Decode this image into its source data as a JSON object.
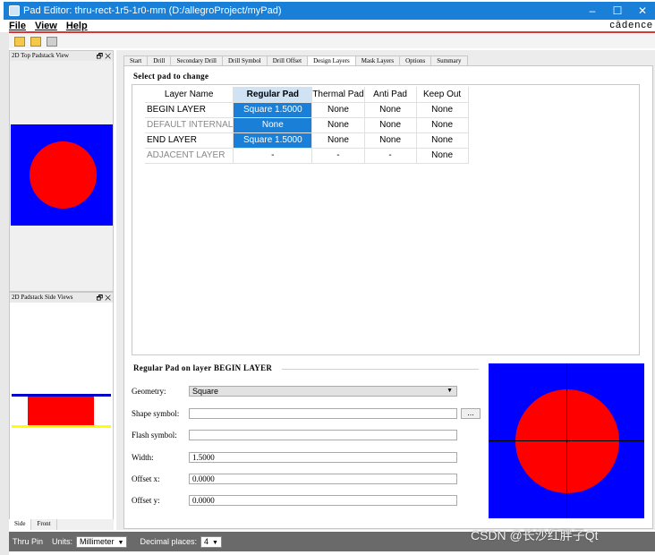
{
  "window": {
    "title": "Pad Editor: thru-rect-1r5-1r0-mm  (D:/allegroProject/myPad)",
    "minimize": "–",
    "maximize": "☐",
    "close": "✕"
  },
  "menu": {
    "items": [
      "File",
      "View",
      "Help"
    ],
    "brand": "cādence"
  },
  "panels": {
    "top_view_title": "2D Top Padstack View",
    "side_view_title": "2D Padstack Side Views",
    "panel_controls": "🗗 ✕",
    "side_tabs": [
      "Side",
      "Front"
    ]
  },
  "tabs": [
    "Start",
    "Drill",
    "Secondary Drill",
    "Drill Symbol",
    "Drill Offset",
    "Design Layers",
    "Mask Layers",
    "Options",
    "Summary"
  ],
  "active_tab": "Design Layers",
  "grid": {
    "section_title": "Select pad to change",
    "headers": [
      "Layer Name",
      "Regular Pad",
      "Thermal Pad",
      "Anti Pad",
      "Keep Out"
    ],
    "rows": [
      {
        "name": "BEGIN LAYER",
        "cells": [
          "Square 1.5000",
          "None",
          "None",
          "None"
        ]
      },
      {
        "name": "DEFAULT INTERNAL",
        "cells": [
          "None",
          "None",
          "None",
          "None"
        ]
      },
      {
        "name": "END LAYER",
        "cells": [
          "Square 1.5000",
          "None",
          "None",
          "None"
        ]
      },
      {
        "name": "ADJACENT LAYER",
        "cells": [
          "-",
          "-",
          "-",
          "None"
        ]
      }
    ]
  },
  "detail": {
    "title": "Regular Pad on layer BEGIN LAYER",
    "geometry_label": "Geometry:",
    "geometry_value": "Square",
    "shape_symbol_label": "Shape symbol:",
    "shape_symbol_value": "",
    "browse_label": "...",
    "flash_symbol_label": "Flash symbol:",
    "flash_symbol_value": "",
    "width_label": "Width:",
    "width_value": "1.5000",
    "offset_x_label": "Offset x:",
    "offset_x_value": "0.0000",
    "offset_y_label": "Offset y:",
    "offset_y_value": "0.0000"
  },
  "status": {
    "mode": "Thru Pin",
    "units_label": "Units:",
    "units_value": "Millimeter",
    "decimal_label": "Decimal places:",
    "decimal_value": "4"
  },
  "watermark": "CSDN @长沙红胖子Qt",
  "colors": {
    "pad_fill": "#ff0000",
    "background": "#0000ff",
    "selection": "#1a7fd6"
  }
}
